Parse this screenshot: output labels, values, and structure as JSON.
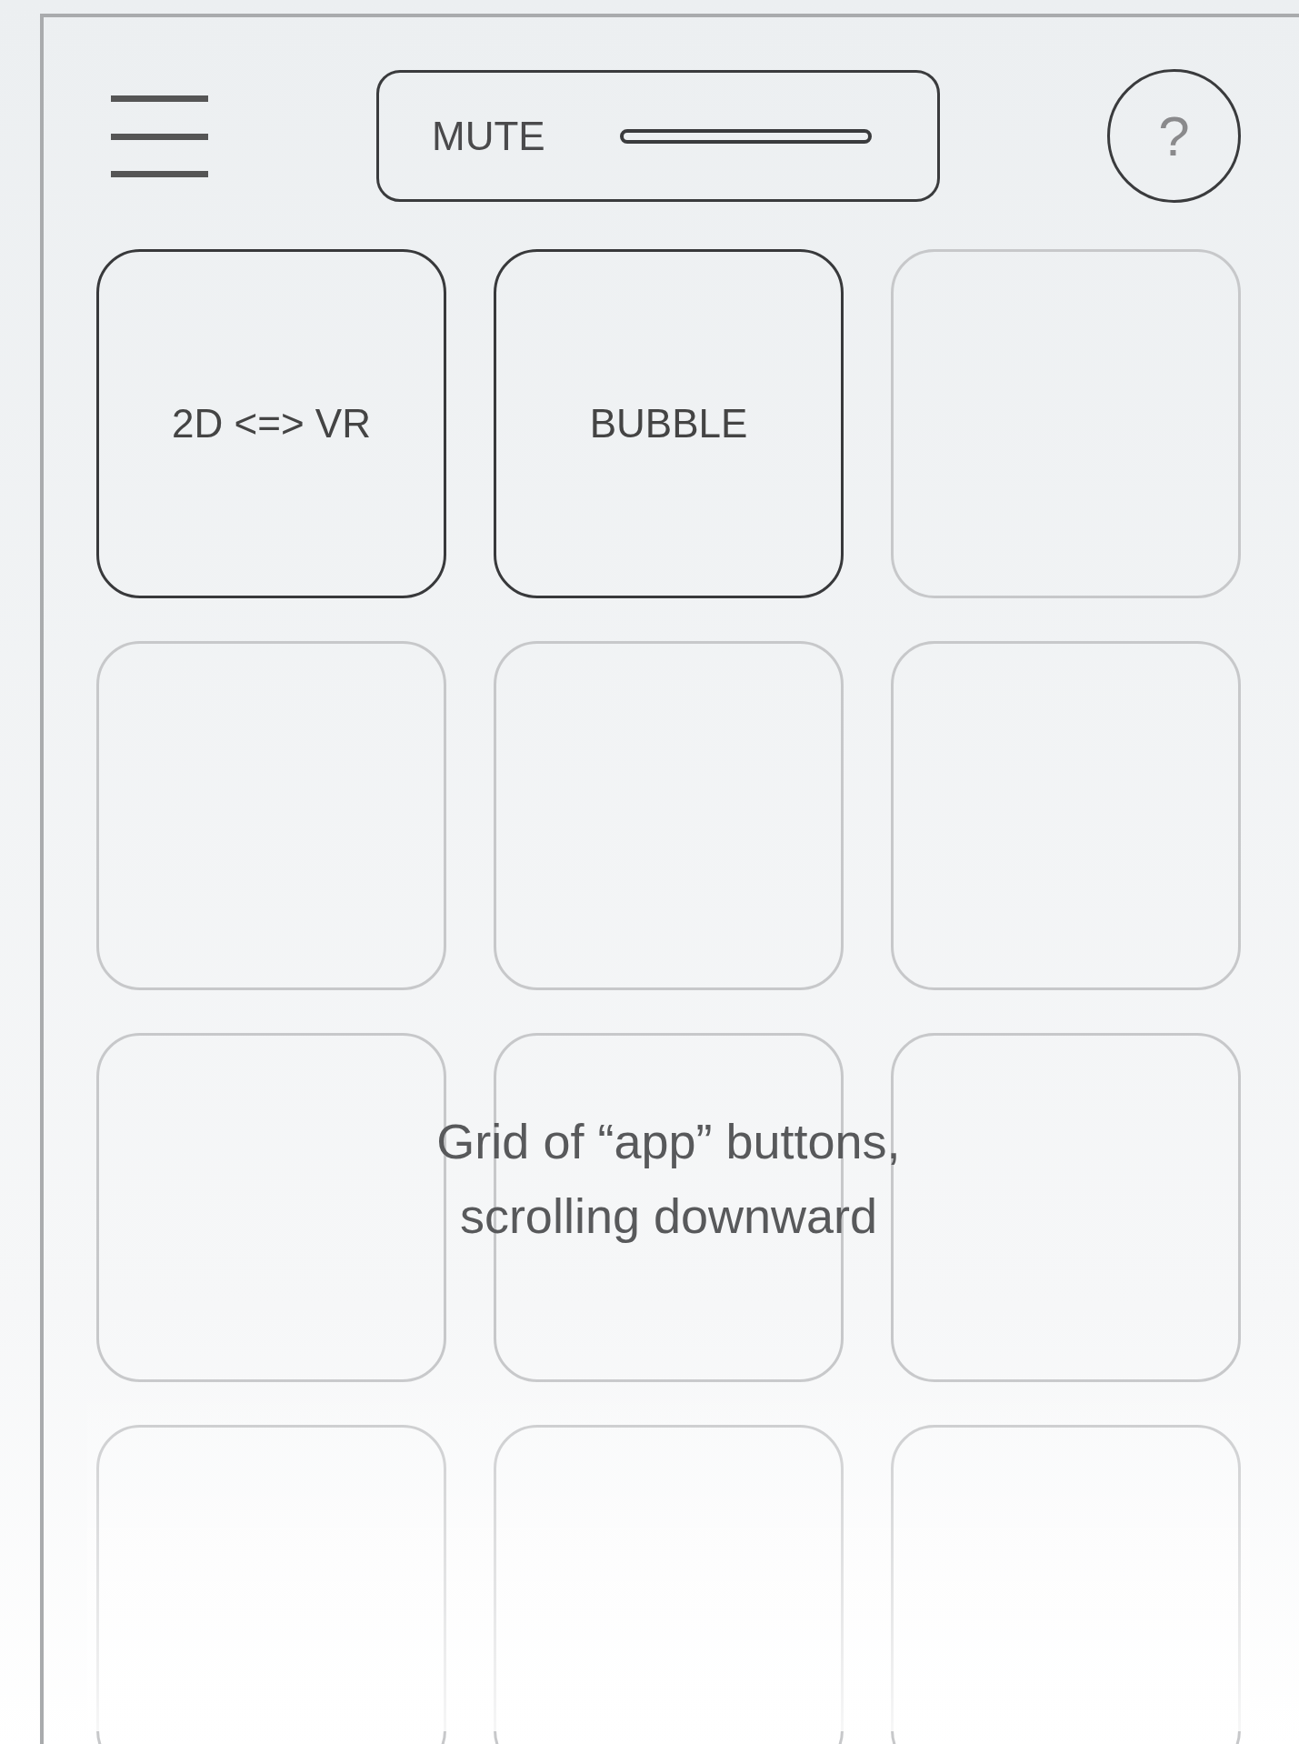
{
  "header": {
    "mute_label": "MUTE",
    "help_symbol": "?"
  },
  "tiles": [
    {
      "label": "2D <=> VR",
      "enabled": true
    },
    {
      "label": "BUBBLE",
      "enabled": true
    },
    {
      "enabled": false
    },
    {
      "enabled": false
    },
    {
      "enabled": false
    },
    {
      "enabled": false
    },
    {
      "enabled": false
    },
    {
      "enabled": false
    },
    {
      "enabled": false
    },
    {
      "enabled": false
    },
    {
      "enabled": false
    },
    {
      "enabled": false
    }
  ],
  "caption": [
    "Grid of “app” buttons,",
    "scrolling downward"
  ]
}
